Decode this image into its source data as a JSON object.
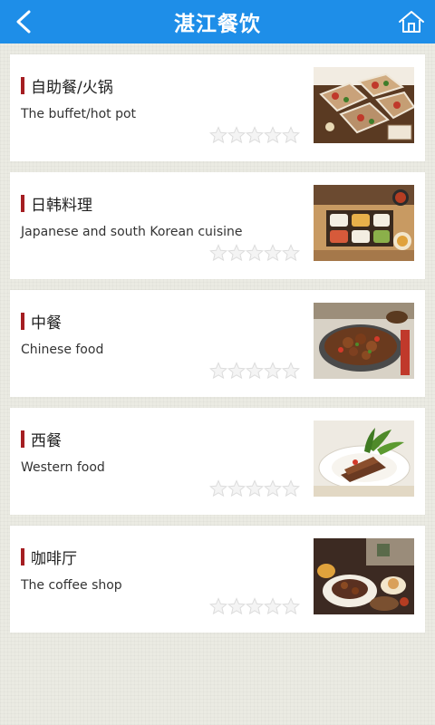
{
  "header": {
    "title": "湛江餐饮",
    "back_icon": "back-arrow-icon",
    "home_icon": "home-icon",
    "background_color": "#1e8ee8"
  },
  "categories": [
    {
      "title": "自助餐/火锅",
      "subtitle": "The buffet/hot pot",
      "rating": 0,
      "image": "buffet-photo"
    },
    {
      "title": "日韩料理",
      "subtitle": "Japanese and south Korean cuisine",
      "rating": 0,
      "image": "japanese-food-photo"
    },
    {
      "title": "中餐",
      "subtitle": "Chinese food",
      "rating": 0,
      "image": "chinese-food-photo"
    },
    {
      "title": "西餐",
      "subtitle": "Western food",
      "rating": 0,
      "image": "western-food-photo"
    },
    {
      "title": "咖啡厅",
      "subtitle": "The coffee shop",
      "rating": 0,
      "image": "coffee-shop-photo"
    }
  ],
  "accent_color": "#a51e22"
}
